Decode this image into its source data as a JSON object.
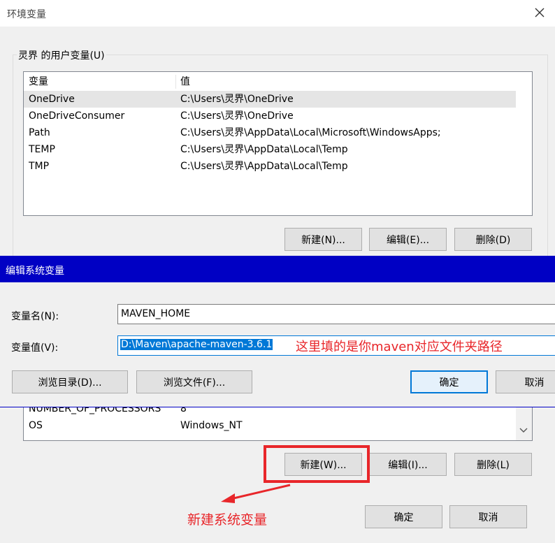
{
  "window": {
    "title": "环境变量"
  },
  "user_vars": {
    "group_label": "灵界 的用户变量(U)",
    "col_variable": "变量",
    "col_value": "值",
    "rows": [
      {
        "name": "OneDrive",
        "value": "C:\\Users\\灵界\\OneDrive"
      },
      {
        "name": "OneDriveConsumer",
        "value": "C:\\Users\\灵界\\OneDrive"
      },
      {
        "name": "Path",
        "value": "C:\\Users\\灵界\\AppData\\Local\\Microsoft\\WindowsApps;"
      },
      {
        "name": "TEMP",
        "value": "C:\\Users\\灵界\\AppData\\Local\\Temp"
      },
      {
        "name": "TMP",
        "value": "C:\\Users\\灵界\\AppData\\Local\\Temp"
      }
    ],
    "new_label": "新建(N)...",
    "edit_label": "编辑(E)...",
    "delete_label": "删除(D)"
  },
  "sys_vars": {
    "rows": [
      {
        "name": "NUMBER_OF_PROCESSORS",
        "value": "8"
      },
      {
        "name": "OS",
        "value": "Windows_NT"
      }
    ],
    "new_label": "新建(W)...",
    "edit_label": "编辑(I)...",
    "delete_label": "删除(L)"
  },
  "edit_dialog": {
    "title": "编辑系统变量",
    "name_label": "变量名(N):",
    "name_value": "MAVEN_HOME",
    "value_label": "变量值(V):",
    "value_value": "D:\\Maven\\apache-maven-3.6.1",
    "browse_dir_label": "浏览目录(D)...",
    "browse_file_label": "浏览文件(F)...",
    "ok_label": "确定",
    "cancel_label": "取消"
  },
  "footer": {
    "ok_label": "确定",
    "cancel_label": "取消"
  },
  "annotations": {
    "value_hint": "这里填的是你maven对应文件夹路径",
    "new_sys_var": "新建系统变量",
    "color": "#e8262a"
  },
  "colors": {
    "dialog_titlebar": "#0000c4",
    "selection": "#0078d7"
  }
}
